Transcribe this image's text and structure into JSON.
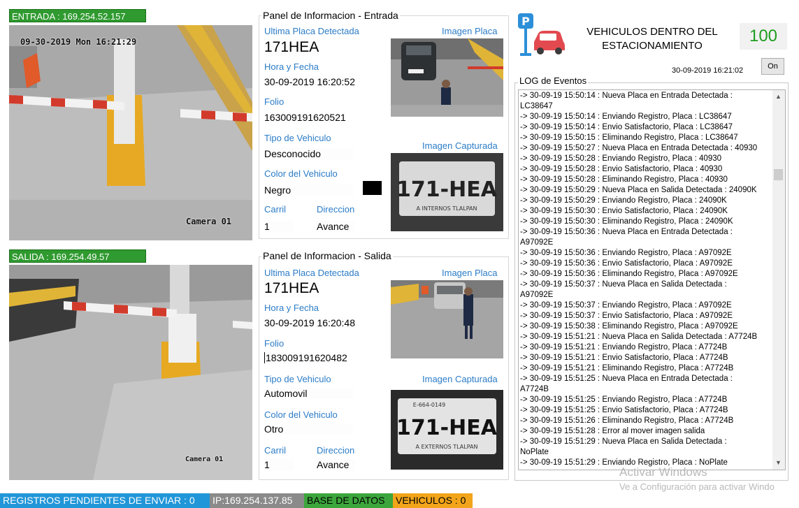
{
  "entrada": {
    "camera_label": "ENTRADA : 169.254.52.157",
    "osd_datetime": "09-30-2019 Mon 16:21:29",
    "osd_camera": "Camera 01",
    "panel_title": "Panel de Informacion - Entrada",
    "last_plate_label": "Ultima Placa Detectada",
    "last_plate": "171HEA",
    "image_label": "Imagen Placa",
    "datetime_label": "Hora y Fecha",
    "datetime": "30-09-2019 16:20:52",
    "folio_label": "Folio",
    "folio": "163009191620521",
    "vehicle_type_label": "Tipo de Vehiculo",
    "vehicle_type": "Desconocido",
    "captured_label": "Imagen Capturada",
    "color_label": "Color del Vehiculo",
    "color": "Negro",
    "color_swatch": "#000000",
    "lane_label": "Carril",
    "lane": "1",
    "direction_label": "Direccion",
    "direction": "Avance",
    "plate_image_text": "171-HEA",
    "plate_image_sub": "A INTERNOS TLALPAN"
  },
  "salida": {
    "camera_label": "SALIDA : 169.254.49.57",
    "osd_camera": "Camera 01",
    "panel_title": "Panel de Informacion - Salida",
    "last_plate_label": "Ultima Placa Detectada",
    "last_plate": "171HEA",
    "image_label": "Imagen Placa",
    "datetime_label": "Hora y Fecha",
    "datetime": "30-09-2019 16:20:48",
    "folio_label": "Folio",
    "folio": "183009191620482",
    "vehicle_type_label": "Tipo de Vehiculo",
    "vehicle_type": "Automovil",
    "captured_label": "Imagen Capturada",
    "color_label": "Color del Vehiculo",
    "color": "Otro",
    "lane_label": "Carril",
    "lane": "1",
    "direction_label": "Direccion",
    "direction": "Avance",
    "plate_image_top": "E-664-0149",
    "plate_image_text": "171-HEA",
    "plate_image_sub": "A EXTERNOS TLALPAN"
  },
  "header": {
    "title_line1": "VEHICULOS DENTRO DEL",
    "title_line2": "ESTACIONAMIENTO",
    "count": "100",
    "clock": "30-09-2019 16:21:02",
    "on_button": "On",
    "log_title": "LOG de Eventos",
    "parking_letter": "P"
  },
  "log": [
    "-> 30-09-19 15:50:14 : Nueva Placa en Entrada Detectada :",
    "LC38647",
    "-> 30-09-19 15:50:14 : Enviando Registro, Placa : LC38647",
    "-> 30-09-19 15:50:14 : Envio Satisfactorio, Placa : LC38647",
    "-> 30-09-19 15:50:15 : Eliminando Registro, Placa : LC38647",
    "-> 30-09-19 15:50:27 : Nueva Placa en Entrada Detectada : 40930",
    "-> 30-09-19 15:50:28 : Enviando Registro, Placa : 40930",
    "-> 30-09-19 15:50:28 : Envio Satisfactorio, Placa : 40930",
    "-> 30-09-19 15:50:28 : Eliminando Registro, Placa : 40930",
    "-> 30-09-19 15:50:29 : Nueva Placa en Salida Detectada : 24090K",
    "-> 30-09-19 15:50:29 : Enviando Registro, Placa : 24090K",
    "-> 30-09-19 15:50:30 : Envio Satisfactorio, Placa : 24090K",
    "-> 30-09-19 15:50:30 : Eliminando Registro, Placa : 24090K",
    "-> 30-09-19 15:50:36 : Nueva Placa en Entrada Detectada :",
    "A97092E",
    "-> 30-09-19 15:50:36 : Enviando Registro, Placa : A97092E",
    "-> 30-09-19 15:50:36 : Envio Satisfactorio, Placa : A97092E",
    "-> 30-09-19 15:50:36 : Eliminando Registro, Placa : A97092E",
    "-> 30-09-19 15:50:37 : Nueva Placa en Salida Detectada :",
    "A97092E",
    "-> 30-09-19 15:50:37 : Enviando Registro, Placa : A97092E",
    "-> 30-09-19 15:50:37 : Envio Satisfactorio, Placa : A97092E",
    "-> 30-09-19 15:50:38 : Eliminando Registro, Placa : A97092E",
    "-> 30-09-19 15:51:21 : Nueva Placa en Salida Detectada : A7724B",
    "-> 30-09-19 15:51:21 : Enviando Registro, Placa : A7724B",
    "-> 30-09-19 15:51:21 : Envio Satisfactorio, Placa : A7724B",
    "-> 30-09-19 15:51:21 : Eliminando Registro, Placa : A7724B",
    "-> 30-09-19 15:51:25 : Nueva Placa en Entrada Detectada :",
    "A7724B",
    "-> 30-09-19 15:51:25 : Enviando Registro, Placa : A7724B",
    "-> 30-09-19 15:51:25 : Envio Satisfactorio, Placa : A7724B",
    "-> 30-09-19 15:51:26 : Eliminando Registro, Placa : A7724B",
    "-> 30-09-19 15:51:28 : Error al mover imagen salida",
    "-> 30-09-19 15:51:29 : Nueva Placa en Salida Detectada :",
    "NoPlate",
    "-> 30-09-19 15:51:29 : Enviando Registro, Placa : NoPlate"
  ],
  "watermark": {
    "line1": "Activar Windows",
    "line2": "Ve a Configuración para activar Windo"
  },
  "status": {
    "pending": "REGISTROS PENDIENTES DE ENVIAR : 0",
    "ip": "IP:169.254.137.85",
    "db": "BASE DE DATOS",
    "vehicles": "VEHICULOS : 0",
    "colors": {
      "pending_bg": "#2196d8",
      "ip_bg": "#8a8a8a",
      "db_bg": "#3ca63c",
      "vehicles_bg": "#f2a51a"
    }
  }
}
